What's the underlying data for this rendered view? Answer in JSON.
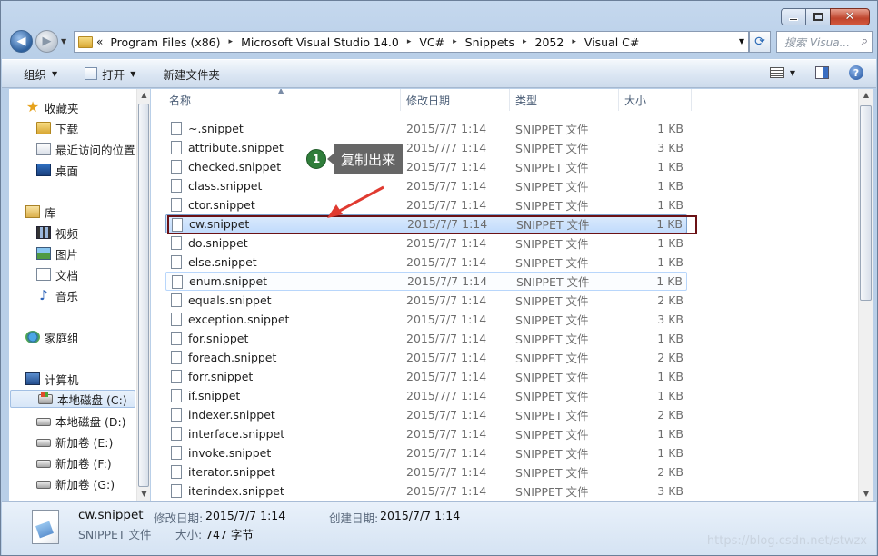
{
  "window": {
    "min_glyph": "",
    "max_glyph": "",
    "close_glyph": "✕"
  },
  "address": {
    "chevron": "«",
    "crumbs": [
      "Program Files (x86)",
      "Microsoft Visual Studio 14.0",
      "VC#",
      "Snippets",
      "2052",
      "Visual C#"
    ],
    "separator": "▸"
  },
  "search": {
    "placeholder": "搜索 Visua..."
  },
  "toolbar": {
    "organize": "组织",
    "open": "打开",
    "new_folder": "新建文件夹"
  },
  "nav": {
    "favorites": "收藏夹",
    "downloads": "下载",
    "recent": "最近访问的位置",
    "desktop": "桌面",
    "libraries": "库",
    "videos": "视频",
    "pictures": "图片",
    "documents": "文档",
    "music": "音乐",
    "homegroup": "家庭组",
    "computer": "计算机",
    "drive_c": "本地磁盘 (C:)",
    "drive_d": "本地磁盘 (D:)",
    "drive_e": "新加卷 (E:)",
    "drive_f": "新加卷 (F:)",
    "drive_g": "新加卷 (G:)"
  },
  "columns": {
    "name": "名称",
    "modified": "修改日期",
    "type": "类型",
    "size": "大小"
  },
  "files": [
    {
      "name": "~.snippet",
      "date": "2015/7/7 1:14",
      "type": "SNIPPET 文件",
      "size": "1 KB"
    },
    {
      "name": "attribute.snippet",
      "date": "2015/7/7 1:14",
      "type": "SNIPPET 文件",
      "size": "3 KB"
    },
    {
      "name": "checked.snippet",
      "date": "2015/7/7 1:14",
      "type": "SNIPPET 文件",
      "size": "1 KB"
    },
    {
      "name": "class.snippet",
      "date": "2015/7/7 1:14",
      "type": "SNIPPET 文件",
      "size": "1 KB"
    },
    {
      "name": "ctor.snippet",
      "date": "2015/7/7 1:14",
      "type": "SNIPPET 文件",
      "size": "1 KB"
    },
    {
      "name": "cw.snippet",
      "date": "2015/7/7 1:14",
      "type": "SNIPPET 文件",
      "size": "1 KB"
    },
    {
      "name": "do.snippet",
      "date": "2015/7/7 1:14",
      "type": "SNIPPET 文件",
      "size": "1 KB"
    },
    {
      "name": "else.snippet",
      "date": "2015/7/7 1:14",
      "type": "SNIPPET 文件",
      "size": "1 KB"
    },
    {
      "name": "enum.snippet",
      "date": "2015/7/7 1:14",
      "type": "SNIPPET 文件",
      "size": "1 KB"
    },
    {
      "name": "equals.snippet",
      "date": "2015/7/7 1:14",
      "type": "SNIPPET 文件",
      "size": "2 KB"
    },
    {
      "name": "exception.snippet",
      "date": "2015/7/7 1:14",
      "type": "SNIPPET 文件",
      "size": "3 KB"
    },
    {
      "name": "for.snippet",
      "date": "2015/7/7 1:14",
      "type": "SNIPPET 文件",
      "size": "1 KB"
    },
    {
      "name": "foreach.snippet",
      "date": "2015/7/7 1:14",
      "type": "SNIPPET 文件",
      "size": "2 KB"
    },
    {
      "name": "forr.snippet",
      "date": "2015/7/7 1:14",
      "type": "SNIPPET 文件",
      "size": "1 KB"
    },
    {
      "name": "if.snippet",
      "date": "2015/7/7 1:14",
      "type": "SNIPPET 文件",
      "size": "1 KB"
    },
    {
      "name": "indexer.snippet",
      "date": "2015/7/7 1:14",
      "type": "SNIPPET 文件",
      "size": "2 KB"
    },
    {
      "name": "interface.snippet",
      "date": "2015/7/7 1:14",
      "type": "SNIPPET 文件",
      "size": "1 KB"
    },
    {
      "name": "invoke.snippet",
      "date": "2015/7/7 1:14",
      "type": "SNIPPET 文件",
      "size": "1 KB"
    },
    {
      "name": "iterator.snippet",
      "date": "2015/7/7 1:14",
      "type": "SNIPPET 文件",
      "size": "2 KB"
    },
    {
      "name": "iterindex.snippet",
      "date": "2015/7/7 1:14",
      "type": "SNIPPET 文件",
      "size": "3 KB"
    }
  ],
  "annotation": {
    "number": "1",
    "text": "复制出来"
  },
  "details": {
    "name": "cw.snippet",
    "type": "SNIPPET 文件",
    "modified_label": "修改日期:",
    "modified_value": "2015/7/7 1:14",
    "created_label": "创建日期:",
    "created_value": "2015/7/7 1:14",
    "size_label": "大小:",
    "size_value": "747 字节"
  },
  "watermark": "https://blog.csdn.net/stwzx",
  "colors": {
    "selection_border": "#7da2ce",
    "highlight_box": "#6b1115",
    "callout_bg": "#666666",
    "badge": "#2f7d3a"
  }
}
